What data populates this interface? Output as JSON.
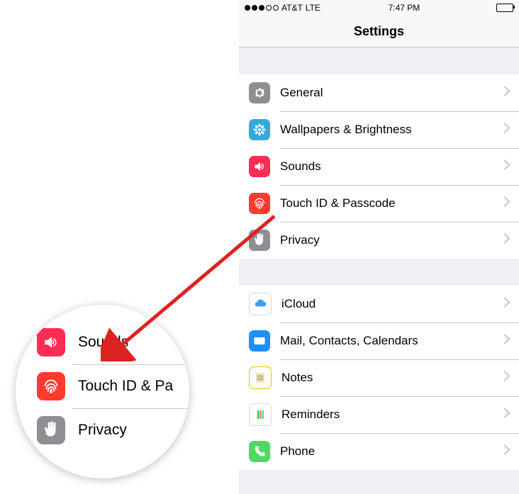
{
  "status": {
    "carrier": "AT&T",
    "network": "LTE",
    "time": "7:47 PM"
  },
  "nav": {
    "title": "Settings"
  },
  "group1": [
    {
      "label": "General",
      "icon": "gear-icon",
      "cls": "c-general"
    },
    {
      "label": "Wallpapers & Brightness",
      "icon": "flower-icon",
      "cls": "c-wall"
    },
    {
      "label": "Sounds",
      "icon": "speaker-icon",
      "cls": "c-sounds"
    },
    {
      "label": "Touch ID & Passcode",
      "icon": "fingerprint-icon",
      "cls": "c-touch"
    },
    {
      "label": "Privacy",
      "icon": "hand-icon",
      "cls": "c-privacy"
    }
  ],
  "group2": [
    {
      "label": "iCloud",
      "icon": "cloud-icon",
      "cls": "c-icloud"
    },
    {
      "label": "Mail, Contacts, Calendars",
      "icon": "mail-icon",
      "cls": "c-mail"
    },
    {
      "label": "Notes",
      "icon": "notes-icon",
      "cls": "c-notes"
    },
    {
      "label": "Reminders",
      "icon": "reminders-icon",
      "cls": "c-reminders"
    },
    {
      "label": "Phone",
      "icon": "phone-icon",
      "cls": "c-phone"
    }
  ],
  "bubble": [
    {
      "label": "Sounds",
      "icon": "speaker-icon",
      "cls": "c-sounds"
    },
    {
      "label": "Touch ID & Pa",
      "icon": "fingerprint-icon",
      "cls": "c-touch"
    },
    {
      "label": "Privacy",
      "icon": "hand-icon",
      "cls": "c-privacy"
    }
  ]
}
